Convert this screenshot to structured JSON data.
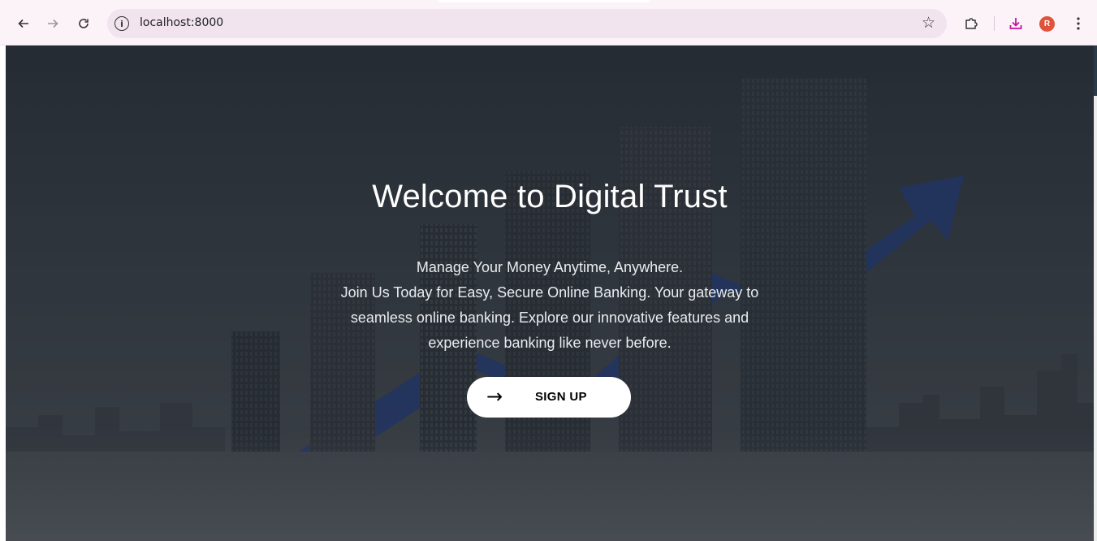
{
  "browser": {
    "url": "localhost:8000",
    "back_icon": "back-arrow-icon",
    "forward_icon": "forward-arrow-icon",
    "reload_icon": "reload-icon",
    "info_glyph": "i",
    "bookmark_icon": "star-icon",
    "extensions_icon": "puzzle-icon",
    "download_icon": "download-icon",
    "profile_initial": "R",
    "menu_icon": "kebab-menu-icon",
    "accent_color": "#c2169a",
    "profile_color": "#e0533a"
  },
  "hero": {
    "title": "Welcome to Digital Trust",
    "subtitle_lines": [
      "Manage Your Money Anytime, Anywhere.",
      "Join Us Today for Easy, Secure Online Banking. Your gateway to",
      "seamless online banking. Explore our innovative features and",
      "experience banking like never before."
    ],
    "cta_label": "SIGN UP",
    "cta_icon": "arrow-right-icon"
  }
}
